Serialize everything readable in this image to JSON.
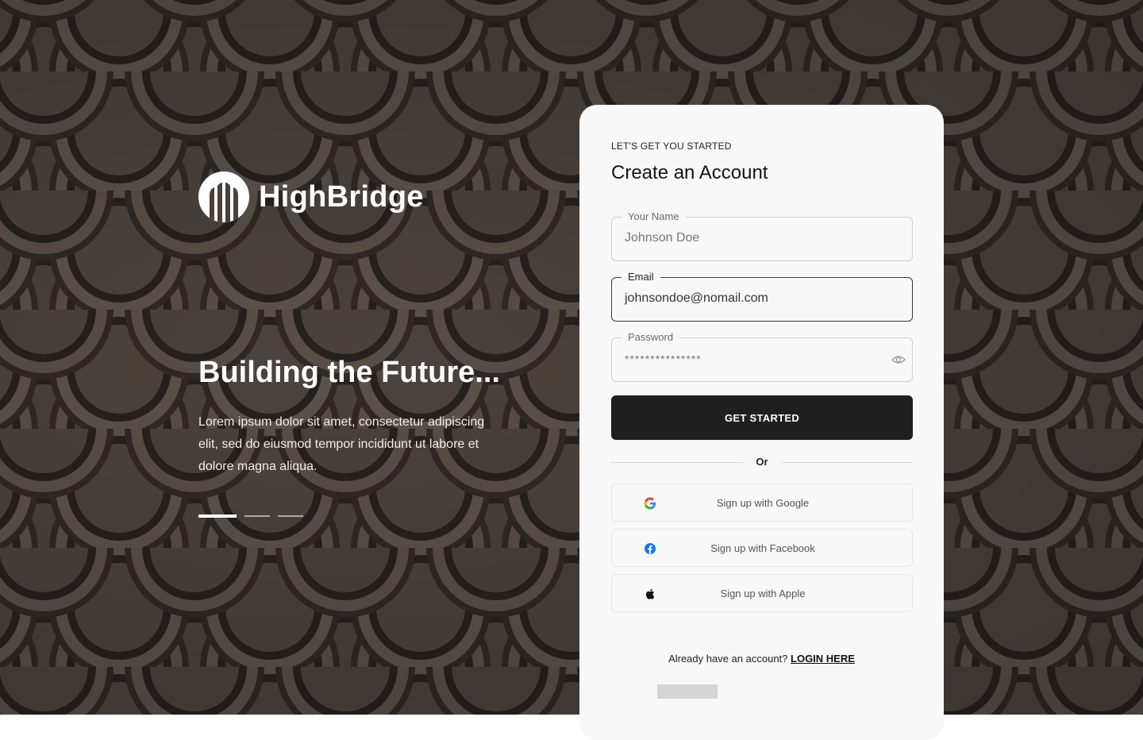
{
  "brand": {
    "name": "HighBridge",
    "logo_icon": "highbridge-logo-icon"
  },
  "hero": {
    "title": "Building the Future...",
    "text": "Lorem ipsum dolor sit amet, consectetur adipiscing elit, sed do eiusmod tempor incididunt ut labore et dolore magna aliqua.",
    "carousel": {
      "total_slides": 3,
      "active_slide": 1
    }
  },
  "form": {
    "eyebrow": "LET'S GET YOU STARTED",
    "title": "Create an Account",
    "fields": {
      "name": {
        "label": "Your Name",
        "value": "",
        "placeholder": "Johnson Doe"
      },
      "email": {
        "label": "Email",
        "value": "johnsondoe@nomail.com",
        "placeholder": ""
      },
      "password": {
        "label": "Password",
        "value": "***************",
        "placeholder": "",
        "icon": "eye-icon"
      }
    },
    "submit_label": "GET STARTED",
    "divider_label": "Or",
    "social": [
      {
        "label": "Sign up with Google",
        "icon": "google-icon"
      },
      {
        "label": "Sign up with Facebook",
        "icon": "facebook-icon"
      },
      {
        "label": "Sign up with Apple",
        "icon": "apple-icon"
      }
    ],
    "footer": {
      "prompt": "Already have an account?",
      "link_label": "LOGIN HERE"
    }
  },
  "colors": {
    "background": "#4a4038",
    "card": "#f8f8f8",
    "primary_button": "#1f1f1f",
    "facebook": "#1877F2"
  }
}
